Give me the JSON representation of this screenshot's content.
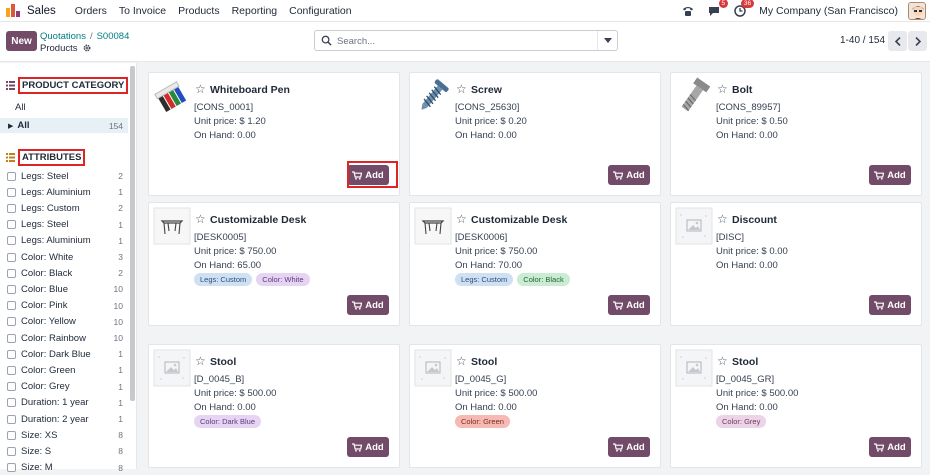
{
  "navbar": {
    "app_name": "Sales",
    "menu": [
      "Orders",
      "To Invoice",
      "Products",
      "Reporting",
      "Configuration"
    ],
    "messages_badge": "5",
    "activity_badge": "36",
    "company": "My Company (San Francisco)"
  },
  "control": {
    "new_label": "New",
    "breadcrumb": [
      "Quotations",
      "S00084"
    ],
    "current": "Products",
    "search_placeholder": "Search...",
    "pager": "1-40 / 154"
  },
  "sidebar": {
    "category_title": "PRODUCT CATEGORY",
    "category_all_heading": "All",
    "category_items": [
      {
        "label": "All",
        "count": "154"
      }
    ],
    "attributes_title": "ATTRIBUTES",
    "attributes": [
      {
        "label": "Legs: Steel",
        "count": "2"
      },
      {
        "label": "Legs: Aluminium",
        "count": "1"
      },
      {
        "label": "Legs: Custom",
        "count": "2"
      },
      {
        "label": "Legs: Steel",
        "count": "1"
      },
      {
        "label": "Legs: Aluminium",
        "count": "1"
      },
      {
        "label": "Color: White",
        "count": "3"
      },
      {
        "label": "Color: Black",
        "count": "2"
      },
      {
        "label": "Color: Blue",
        "count": "10"
      },
      {
        "label": "Color: Pink",
        "count": "10"
      },
      {
        "label": "Color: Yellow",
        "count": "10"
      },
      {
        "label": "Color: Rainbow",
        "count": "10"
      },
      {
        "label": "Color: Dark Blue",
        "count": "1"
      },
      {
        "label": "Color: Green",
        "count": "1"
      },
      {
        "label": "Color: Grey",
        "count": "1"
      },
      {
        "label": "Duration: 1 year",
        "count": "1"
      },
      {
        "label": "Duration: 2 year",
        "count": "1"
      },
      {
        "label": "Size: XS",
        "count": "8"
      },
      {
        "label": "Size: S",
        "count": "8"
      },
      {
        "label": "Size: M",
        "count": "8"
      }
    ]
  },
  "products": [
    {
      "name": "Whiteboard Pen",
      "ref": "[CONS_0001]",
      "price": "Unit price: $ 1.20",
      "on_hand": "On Hand: 0.00",
      "tags": [],
      "icon": "whiteboard-pen-icon"
    },
    {
      "name": "Screw",
      "ref": "[CONS_25630]",
      "price": "Unit price: $ 0.20",
      "on_hand": "On Hand: 0.00",
      "tags": [],
      "icon": "screw-icon"
    },
    {
      "name": "Bolt",
      "ref": "[CONS_89957]",
      "price": "Unit price: $ 0.50",
      "on_hand": "On Hand: 0.00",
      "tags": [],
      "icon": "bolt-icon"
    },
    {
      "name": "Customizable Desk",
      "ref": "[DESK0005]",
      "price": "Unit price: $ 750.00",
      "on_hand": "On Hand: 65.00",
      "tags": [
        {
          "label": "Legs: Custom",
          "bg": "#cfe0f3",
          "fg": "#2b4f7a"
        },
        {
          "label": "Color: White",
          "bg": "#e6d4f3",
          "fg": "#5b3a7a"
        }
      ],
      "icon": "desk-icon"
    },
    {
      "name": "Customizable Desk",
      "ref": "[DESK0006]",
      "price": "Unit price: $ 750.00",
      "on_hand": "On Hand: 70.00",
      "tags": [
        {
          "label": "Legs: Custom",
          "bg": "#cfe0f3",
          "fg": "#2b4f7a"
        },
        {
          "label": "Color: Black",
          "bg": "#c9ecd2",
          "fg": "#24633a"
        }
      ],
      "icon": "desk-icon"
    },
    {
      "name": "Discount",
      "ref": "[DISC]",
      "price": "Unit price: $ 0.00",
      "on_hand": "On Hand: 0.00",
      "tags": [],
      "icon": "placeholder-image-icon"
    },
    {
      "name": "Stool",
      "ref": "[D_0045_B]",
      "price": "Unit price: $ 500.00",
      "on_hand": "On Hand: 0.00",
      "tags": [
        {
          "label": "Color: Dark Blue",
          "bg": "#e6d4f3",
          "fg": "#5b3a7a"
        }
      ],
      "icon": "placeholder-image-icon"
    },
    {
      "name": "Stool",
      "ref": "[D_0045_G]",
      "price": "Unit price: $ 500.00",
      "on_hand": "On Hand: 0.00",
      "tags": [
        {
          "label": "Color: Green",
          "bg": "#f6b9b3",
          "fg": "#7a2b24"
        }
      ],
      "icon": "placeholder-image-icon"
    },
    {
      "name": "Stool",
      "ref": "[D_0045_GR]",
      "price": "Unit price: $ 500.00",
      "on_hand": "On Hand: 0.00",
      "tags": [
        {
          "label": "Color: Grey",
          "bg": "#ecd3e6",
          "fg": "#6b3a5e"
        }
      ],
      "icon": "placeholder-image-icon"
    }
  ],
  "add_label": "Add",
  "colors": {
    "brand": "#714b67",
    "link": "#017e84",
    "highlight": "#dc2626"
  }
}
